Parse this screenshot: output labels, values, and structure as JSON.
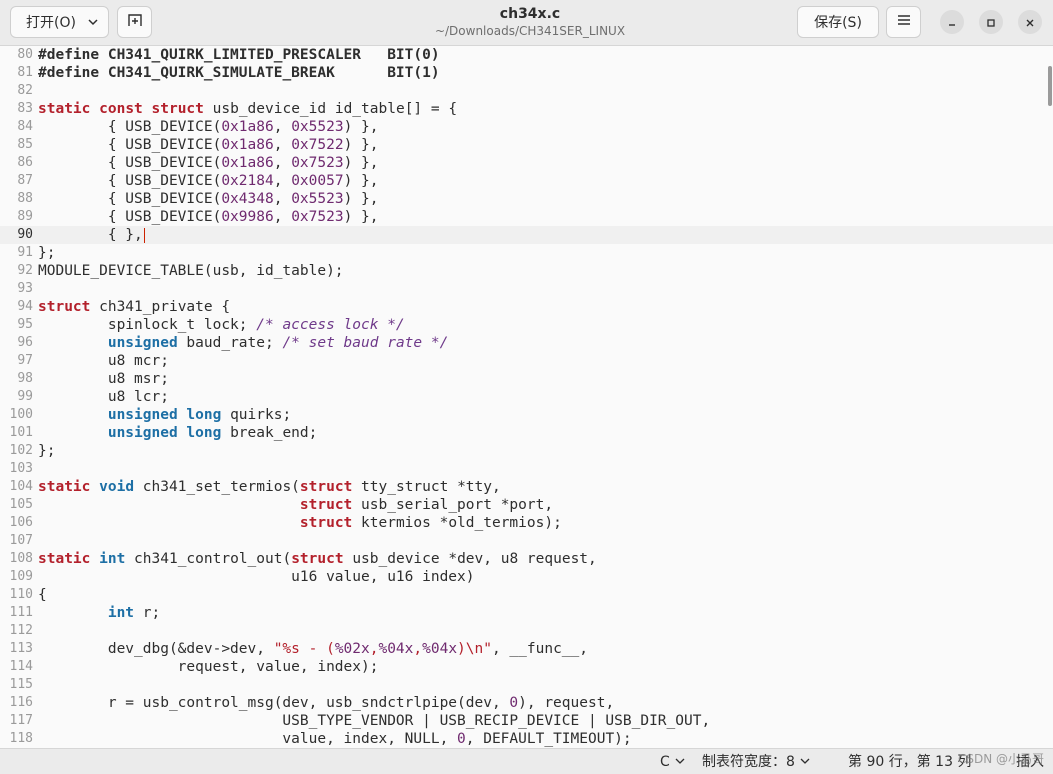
{
  "header": {
    "open_label": "打开(O)",
    "title": "ch34x.c",
    "subtitle": "~/Downloads/CH341SER_LINUX",
    "save_label": "保存(S)"
  },
  "editor": {
    "current_line": 90,
    "lines": [
      {
        "n": "80",
        "t": [
          [
            "#define ",
            "pp"
          ],
          [
            "CH341_QUIRK_LIMITED_PRESCALER   BIT(0)",
            "pp"
          ]
        ]
      },
      {
        "n": "81",
        "t": [
          [
            "#define ",
            "pp"
          ],
          [
            "CH341_QUIRK_SIMULATE_BREAK      BIT(1)",
            "pp"
          ]
        ]
      },
      {
        "n": "82",
        "t": []
      },
      {
        "n": "83",
        "t": [
          [
            "static",
            "kw"
          ],
          [
            " "
          ],
          [
            "const",
            "kw"
          ],
          [
            " "
          ],
          [
            "struct",
            "kw"
          ],
          [
            " usb_device_id id_table[] = {"
          ]
        ]
      },
      {
        "n": "84",
        "t": [
          [
            "        { USB_DEVICE("
          ],
          [
            "0x1a86",
            "num"
          ],
          [
            ", "
          ],
          [
            "0x5523",
            "num"
          ],
          [
            ") },"
          ]
        ]
      },
      {
        "n": "85",
        "t": [
          [
            "        { USB_DEVICE("
          ],
          [
            "0x1a86",
            "num"
          ],
          [
            ", "
          ],
          [
            "0x7522",
            "num"
          ],
          [
            ") },"
          ]
        ]
      },
      {
        "n": "86",
        "t": [
          [
            "        { USB_DEVICE("
          ],
          [
            "0x1a86",
            "num"
          ],
          [
            ", "
          ],
          [
            "0x7523",
            "num"
          ],
          [
            ") },"
          ]
        ]
      },
      {
        "n": "87",
        "t": [
          [
            "        { USB_DEVICE("
          ],
          [
            "0x2184",
            "num"
          ],
          [
            ", "
          ],
          [
            "0x0057",
            "num"
          ],
          [
            ") },"
          ]
        ]
      },
      {
        "n": "88",
        "t": [
          [
            "        { USB_DEVICE("
          ],
          [
            "0x4348",
            "num"
          ],
          [
            ", "
          ],
          [
            "0x5523",
            "num"
          ],
          [
            ") },"
          ]
        ]
      },
      {
        "n": "89",
        "t": [
          [
            "        { USB_DEVICE("
          ],
          [
            "0x9986",
            "num"
          ],
          [
            ", "
          ],
          [
            "0x7523",
            "num"
          ],
          [
            ") },"
          ]
        ]
      },
      {
        "n": "90",
        "t": [
          [
            "        { },"
          ]
        ]
      },
      {
        "n": "91",
        "t": [
          [
            "};"
          ]
        ]
      },
      {
        "n": "92",
        "t": [
          [
            "MODULE_DEVICE_TABLE(usb, id_table);"
          ]
        ]
      },
      {
        "n": "93",
        "t": []
      },
      {
        "n": "94",
        "t": [
          [
            "struct",
            "kw"
          ],
          [
            " ch341_private {"
          ]
        ]
      },
      {
        "n": "95",
        "t": [
          [
            "        spinlock_t lock; "
          ],
          [
            "/* access lock */",
            "cm"
          ]
        ]
      },
      {
        "n": "96",
        "t": [
          [
            "        "
          ],
          [
            "unsigned",
            "ty"
          ],
          [
            " baud_rate; "
          ],
          [
            "/* set baud rate */",
            "cm"
          ]
        ]
      },
      {
        "n": "97",
        "t": [
          [
            "        u8 mcr;"
          ]
        ]
      },
      {
        "n": "98",
        "t": [
          [
            "        u8 msr;"
          ]
        ]
      },
      {
        "n": "99",
        "t": [
          [
            "        u8 lcr;"
          ]
        ]
      },
      {
        "n": "100",
        "t": [
          [
            "        "
          ],
          [
            "unsigned",
            "ty"
          ],
          [
            " "
          ],
          [
            "long",
            "ty"
          ],
          [
            " quirks;"
          ]
        ]
      },
      {
        "n": "101",
        "t": [
          [
            "        "
          ],
          [
            "unsigned",
            "ty"
          ],
          [
            " "
          ],
          [
            "long",
            "ty"
          ],
          [
            " break_end;"
          ]
        ]
      },
      {
        "n": "102",
        "t": [
          [
            "};"
          ]
        ]
      },
      {
        "n": "103",
        "t": []
      },
      {
        "n": "104",
        "t": [
          [
            "static",
            "kw"
          ],
          [
            " "
          ],
          [
            "void",
            "ty"
          ],
          [
            " ch341_set_termios("
          ],
          [
            "struct",
            "kw"
          ],
          [
            " tty_struct *tty,"
          ]
        ]
      },
      {
        "n": "105",
        "t": [
          [
            "                              "
          ],
          [
            "struct",
            "kw"
          ],
          [
            " usb_serial_port *port,"
          ]
        ]
      },
      {
        "n": "106",
        "t": [
          [
            "                              "
          ],
          [
            "struct",
            "kw"
          ],
          [
            " ktermios *old_termios);"
          ]
        ]
      },
      {
        "n": "107",
        "t": []
      },
      {
        "n": "108",
        "t": [
          [
            "static",
            "kw"
          ],
          [
            " "
          ],
          [
            "int",
            "ty"
          ],
          [
            " ch341_control_out("
          ],
          [
            "struct",
            "kw"
          ],
          [
            " usb_device *dev, u8 request,"
          ]
        ]
      },
      {
        "n": "109",
        "t": [
          [
            "                             u16 value, u16 index)"
          ]
        ]
      },
      {
        "n": "110",
        "t": [
          [
            "{"
          ]
        ]
      },
      {
        "n": "111",
        "t": [
          [
            "        "
          ],
          [
            "int",
            "ty"
          ],
          [
            " r;"
          ]
        ]
      },
      {
        "n": "112",
        "t": []
      },
      {
        "n": "113",
        "t": [
          [
            "        dev_dbg(&dev->dev, "
          ],
          [
            "\"%s - (",
            "str"
          ],
          [
            "%02x",
            "num"
          ],
          [
            ",",
            "str"
          ],
          [
            "%04x",
            "num"
          ],
          [
            ",",
            "str"
          ],
          [
            "%04x",
            "num"
          ],
          [
            ")\\n\"",
            "str"
          ],
          [
            ", __func__,"
          ]
        ]
      },
      {
        "n": "114",
        "t": [
          [
            "                request, value, index);"
          ]
        ]
      },
      {
        "n": "115",
        "t": []
      },
      {
        "n": "116",
        "t": [
          [
            "        r = usb_control_msg(dev, usb_sndctrlpipe(dev, "
          ],
          [
            "0",
            "num"
          ],
          [
            "), request,"
          ]
        ]
      },
      {
        "n": "117",
        "t": [
          [
            "                            USB_TYPE_VENDOR | USB_RECIP_DEVICE | USB_DIR_OUT,"
          ]
        ]
      },
      {
        "n": "118",
        "t": [
          [
            "                            value, index, NULL, "
          ],
          [
            "0",
            "num"
          ],
          [
            ", DEFAULT_TIMEOUT);"
          ]
        ]
      }
    ]
  },
  "status": {
    "language": "C",
    "tab_width": "制表符宽度：8",
    "position": "第 90 行，第 13 列",
    "mode": "插入",
    "watermark": "CSDN @小马哥"
  }
}
